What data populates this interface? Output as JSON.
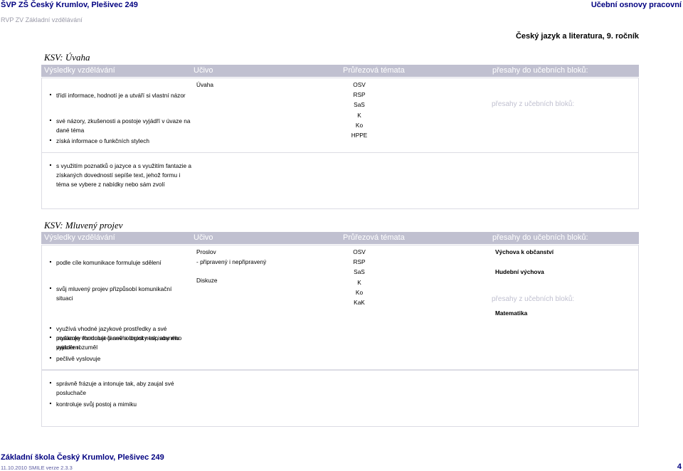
{
  "header": {
    "school": "ŠVP ZŠ Český Krumlov, Plešivec 249",
    "doc_type": "Učební osnovy pracovní",
    "rvp": "RVP ZV Základní vzdělávání",
    "subject": "Český jazyk a literatura, 9. ročník"
  },
  "columns": {
    "vysledky": "Výsledky vzdělávání",
    "ucivo": "Učivo",
    "prurezova": "Průřezová témata",
    "presahy": "přesahy do učebních bloků:",
    "presahy_z": "přesahy z učebních bloků:"
  },
  "section1": {
    "title": "KSV: Úvaha",
    "outcomes": [
      "třídí informace, hodnotí je a utváří si vlastní názor",
      "své názory, zkušenosti a postoje vyjádří v úvaze na dané téma",
      "získá informace o funkčních stylech"
    ],
    "outcomes_extra": [
      "s využitím poznatků o jazyce a s využitím fantazie a získaných dovedností sepíše text, jehož formu i téma se vybere z nabídky nebo sám zvolí"
    ],
    "ucivo": [
      "Úvaha"
    ],
    "themes": [
      "OSV",
      "RSP",
      "SaS",
      "K",
      "Ko",
      "HPPE"
    ]
  },
  "section2": {
    "title": "KSV: Mluvený projev",
    "outcomes": [
      "podle cíle komunikace formuluje sdělení",
      "svůj mluvený projev přizpůsobí komunikační situaci",
      "využívá vhodné jazykové prostředky a své myšlenky formuluje jasně a logicky tak, aby mu partner rozuměl",
      "posuzuje vhodnost či nevhodnost nespisovného vyjádření",
      "pečlivě vyslovuje"
    ],
    "outcomes_extra": [
      "správně frázuje a intonuje tak, aby zaujal své posluchače",
      "kontroluje svůj postoj a mimiku"
    ],
    "ucivo": [
      "Proslov",
      "- připravený i nepřipravený",
      "Diskuze"
    ],
    "themes": [
      "OSV",
      "RSP",
      "SaS",
      "K",
      "Ko",
      "KaK"
    ],
    "presahy_do": [
      "Výchova k občanství",
      "Hudební výchova"
    ],
    "presahy_z": [
      "Matematika"
    ]
  },
  "footer": {
    "school": "Základní škola Český Krumlov, Plešivec 249",
    "date": "11.10.2010 SMILE verze 2.3.3",
    "page": "4"
  }
}
